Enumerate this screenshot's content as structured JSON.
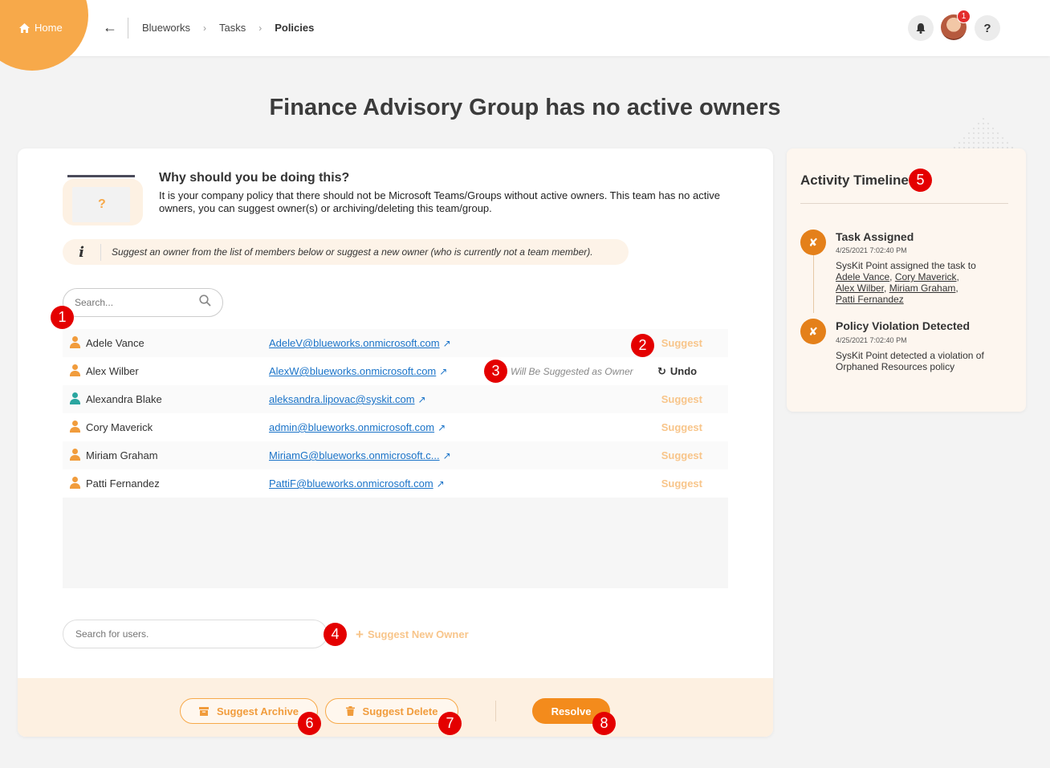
{
  "header": {
    "home_label": "Home",
    "breadcrumbs": [
      "Blueworks",
      "Tasks",
      "Policies"
    ],
    "notification_count": "1"
  },
  "page": {
    "title": "Finance Advisory Group has no active owners"
  },
  "why": {
    "title": "Why should you be doing this?",
    "text": "It is your company policy that there should not be Microsoft Teams/Groups without active owners. This team has no active owners, you can suggest owner(s) or archiving/deleting this team/group.",
    "illustration_mark": "?"
  },
  "info": {
    "icon_label": "i",
    "text": "Suggest an owner from the list of members below or suggest a new owner (who is currently not a team member)."
  },
  "member_search": {
    "placeholder": "Search..."
  },
  "members": [
    {
      "name": "Adele Vance",
      "email": "AdeleV@blueworks.onmicrosoft.com",
      "action": "Suggest",
      "icon_color": "#f19c3c",
      "status": ""
    },
    {
      "name": "Alex Wilber",
      "email": "AlexW@blueworks.onmicrosoft.com",
      "action": "Undo",
      "icon_color": "#f19c3c",
      "status": "Will Be Suggested as Owner"
    },
    {
      "name": "Alexandra Blake",
      "email": "aleksandra.lipovac@syskit.com",
      "action": "Suggest",
      "icon_color": "#2aa6a0",
      "status": ""
    },
    {
      "name": "Cory Maverick",
      "email": "admin@blueworks.onmicrosoft.com",
      "action": "Suggest",
      "icon_color": "#f19c3c",
      "status": ""
    },
    {
      "name": "Miriam Graham",
      "email": "MiriamG@blueworks.onmicrosoft.c...",
      "action": "Suggest",
      "icon_color": "#f19c3c",
      "status": ""
    },
    {
      "name": "Patti Fernandez",
      "email": "PattiF@blueworks.onmicrosoft.com",
      "action": "Suggest",
      "icon_color": "#f19c3c",
      "status": ""
    }
  ],
  "new_owner": {
    "placeholder": "Search for users.",
    "button_label": "Suggest New Owner"
  },
  "footer": {
    "archive_label": "Suggest Archive",
    "delete_label": "Suggest Delete",
    "resolve_label": "Resolve"
  },
  "timeline": {
    "title": "Activity Timeline",
    "events": [
      {
        "title": "Task Assigned",
        "time": "4/25/2021 7:02:40 PM",
        "text_prefix": "SysKit Point assigned the task to",
        "users": [
          "Adele Vance",
          "Cory Maverick",
          "Alex Wilber",
          "Miriam Graham",
          "Patti Fernandez"
        ]
      },
      {
        "title": "Policy Violation Detected",
        "time": "4/25/2021 7:02:40 PM",
        "text": "SysKit Point detected a violation of Orphaned Resources policy"
      }
    ]
  },
  "markers": [
    "1",
    "2",
    "3",
    "4",
    "5",
    "6",
    "7",
    "8"
  ],
  "colors": {
    "accent": "#f38b1c",
    "accent_light": "#f8c58a",
    "marker": "#e40000",
    "link": "#1a73c8"
  }
}
